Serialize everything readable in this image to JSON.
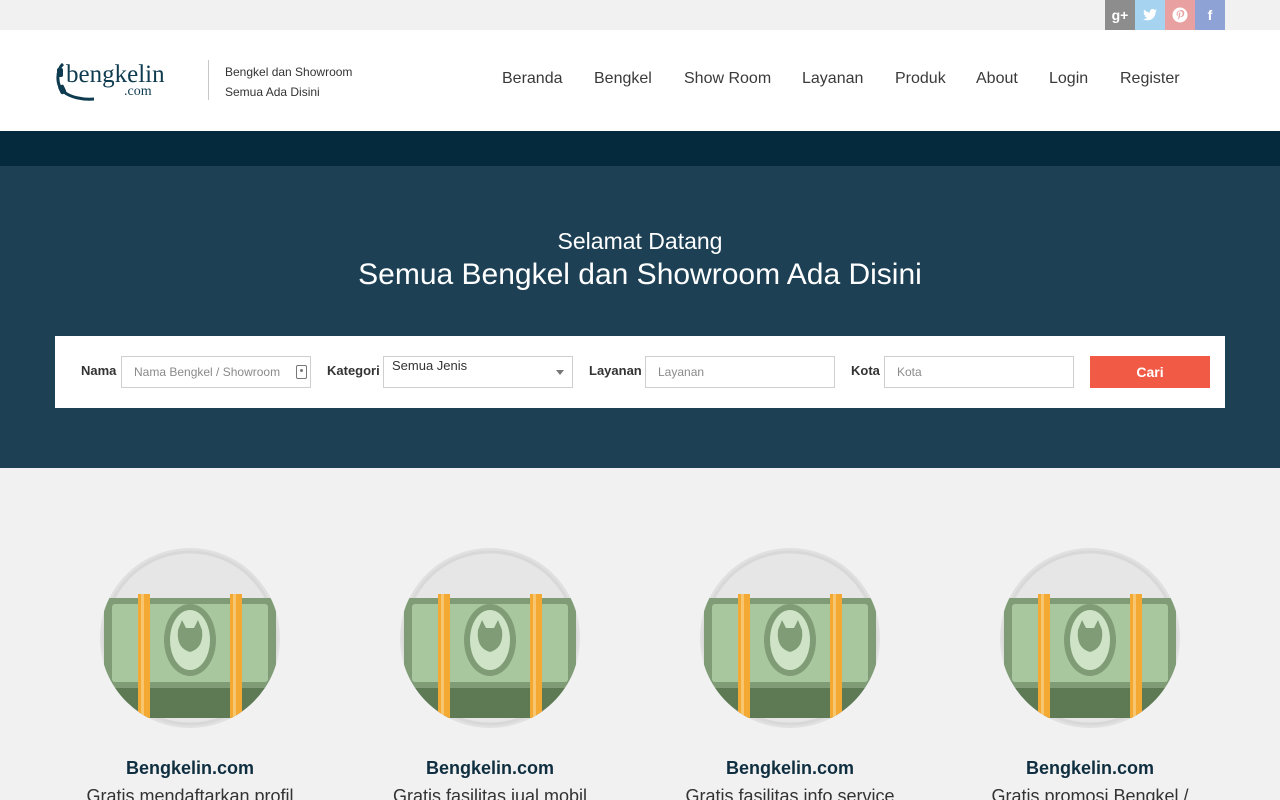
{
  "social": {
    "google_plus": "g+",
    "twitter": "t",
    "pinterest": "p",
    "facebook": "f"
  },
  "header": {
    "logo_text": "bengkelin",
    "logo_sub": ".com",
    "tagline_line1": "Bengkel dan Showroom",
    "tagline_line2": "Semua Ada Disini"
  },
  "nav": [
    {
      "label": "Beranda"
    },
    {
      "label": "Bengkel"
    },
    {
      "label": "Show Room"
    },
    {
      "label": "Layanan"
    },
    {
      "label": "Produk"
    },
    {
      "label": "About"
    },
    {
      "label": "Login"
    },
    {
      "label": "Register"
    }
  ],
  "hero": {
    "subtitle": "Selamat Datang",
    "title": "Semua Bengkel dan Showroom Ada Disini"
  },
  "search": {
    "nama_label": "Nama",
    "nama_placeholder": "Nama Bengkel / Showroom",
    "kategori_label": "Kategori",
    "kategori_value": "Semua Jenis",
    "layanan_label": "Layanan",
    "layanan_placeholder": "Layanan",
    "kota_label": "Kota",
    "kota_placeholder": "Kota",
    "button_label": "Cari"
  },
  "features": [
    {
      "title": "Bengkelin.com",
      "desc": "Gratis mendaftarkan profil"
    },
    {
      "title": "Bengkelin.com",
      "desc": "Gratis fasilitas jual mobil"
    },
    {
      "title": "Bengkelin.com",
      "desc": "Gratis fasilitas info service"
    },
    {
      "title": "Bengkelin.com",
      "desc": "Gratis promosi Bengkel /"
    }
  ],
  "colors": {
    "brand_dark": "#1d4055",
    "strip": "#052a3d",
    "accent": "#f15a45"
  }
}
